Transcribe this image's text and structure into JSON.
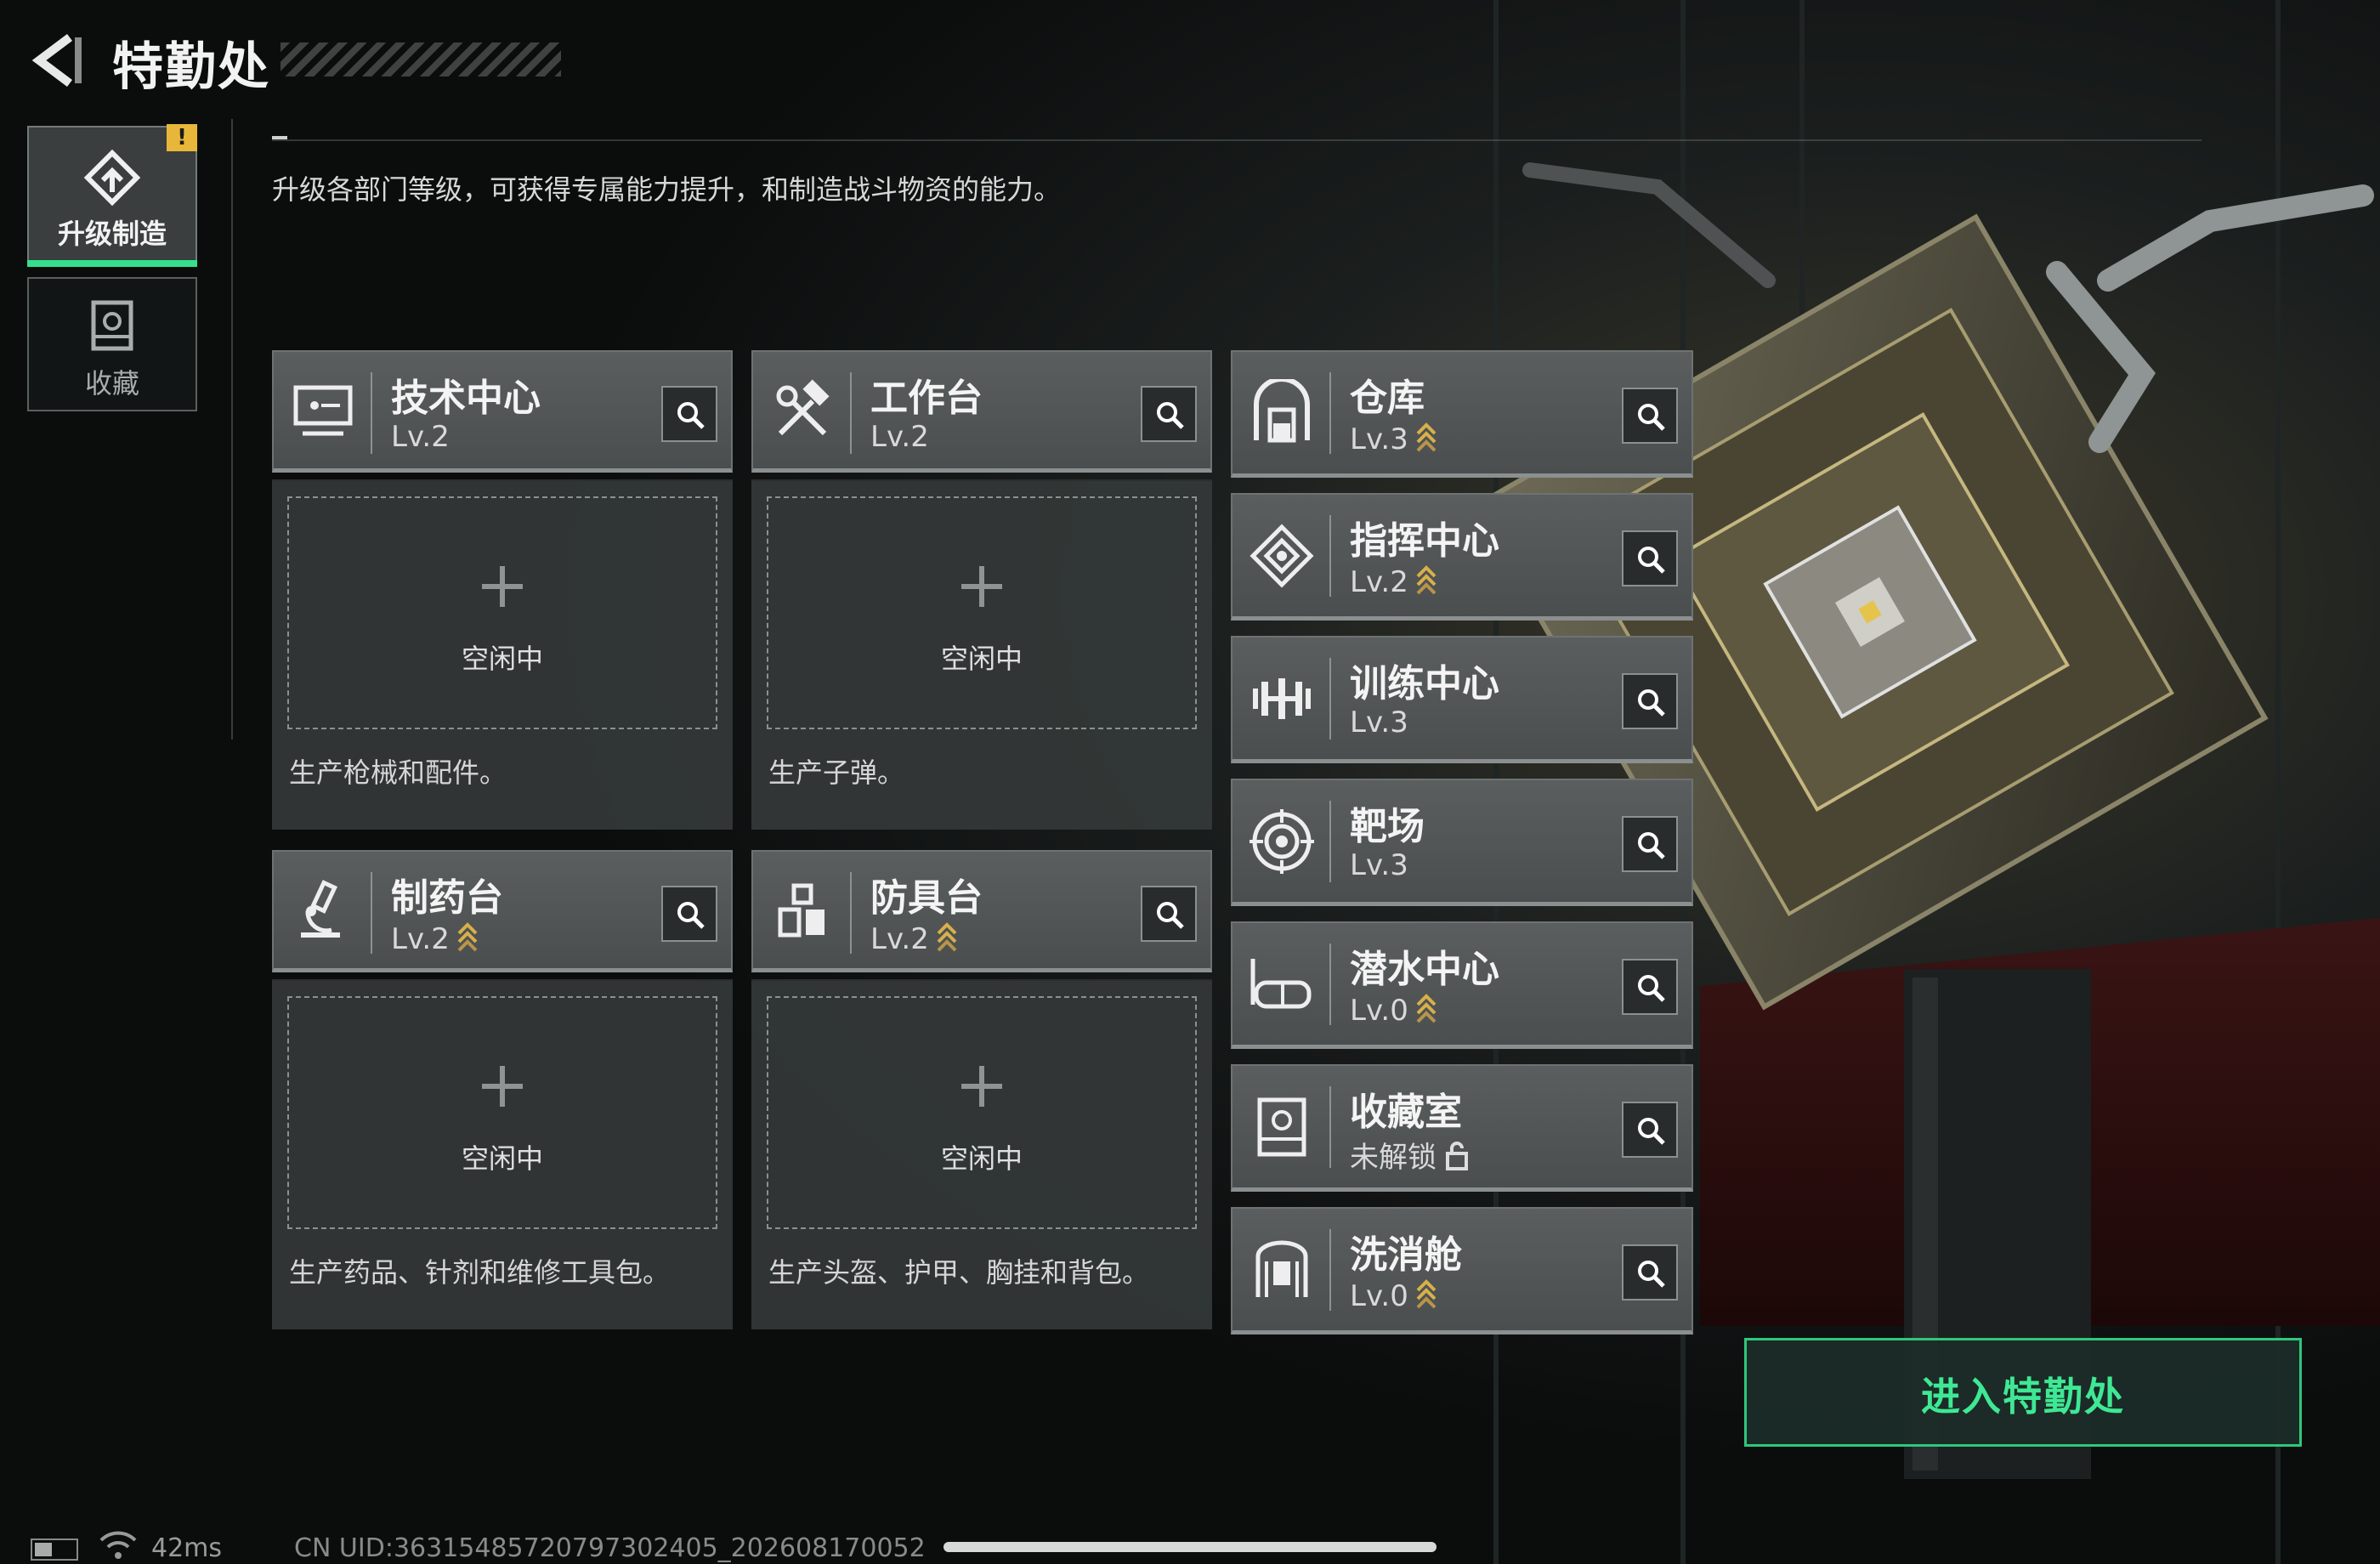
{
  "header": {
    "title": "特勤处"
  },
  "nav": {
    "items": [
      {
        "label": "升级制造",
        "active": true,
        "alert": "!"
      },
      {
        "label": "收藏",
        "active": false
      }
    ]
  },
  "description": "升级各部门等级，可获得专属能力提升，和制造战斗物资的能力。",
  "main_cards": [
    {
      "name": "技术中心",
      "level": "Lv.2",
      "upgradeable": false,
      "icon": "monitor-icon",
      "slot_status": "空闲中",
      "desc": "生产枪械和配件。"
    },
    {
      "name": "工作台",
      "level": "Lv.2",
      "upgradeable": false,
      "icon": "hammer-wrench-icon",
      "slot_status": "空闲中",
      "desc": "生产子弹。"
    },
    {
      "name": "制药台",
      "level": "Lv.2",
      "upgradeable": true,
      "icon": "microscope-icon",
      "slot_status": "空闲中",
      "desc": "生产药品、针剂和维修工具包。"
    },
    {
      "name": "防具台",
      "level": "Lv.2",
      "upgradeable": true,
      "icon": "armor-icon",
      "slot_status": "空闲中",
      "desc": "生产头盔、护甲、胸挂和背包。"
    }
  ],
  "facilities": [
    {
      "name": "仓库",
      "level": "Lv.3",
      "upgradeable": true,
      "icon": "warehouse-icon"
    },
    {
      "name": "指挥中心",
      "level": "Lv.2",
      "upgradeable": true,
      "icon": "command-diamond-icon"
    },
    {
      "name": "训练中心",
      "level": "Lv.3",
      "upgradeable": false,
      "icon": "dumbbell-icon"
    },
    {
      "name": "靶场",
      "level": "Lv.3",
      "upgradeable": false,
      "icon": "target-icon"
    },
    {
      "name": "潜水中心",
      "level": "Lv.0",
      "upgradeable": true,
      "icon": "diving-mask-icon"
    },
    {
      "name": "收藏室",
      "level": "未解锁",
      "upgradeable": false,
      "locked": true,
      "icon": "trophy-case-icon"
    },
    {
      "name": "洗消舱",
      "level": "Lv.0",
      "upgradeable": true,
      "icon": "decon-chamber-icon"
    }
  ],
  "enter_button": {
    "label": "进入特勤处"
  },
  "status_bar": {
    "ping": "42ms",
    "uid": "CN UID:3631548572079730240​5_20260817005​2"
  },
  "colors": {
    "accent_green": "#35e08e",
    "alert_yellow": "#e8b73a",
    "upgrade_gold": "#d8b04a"
  }
}
